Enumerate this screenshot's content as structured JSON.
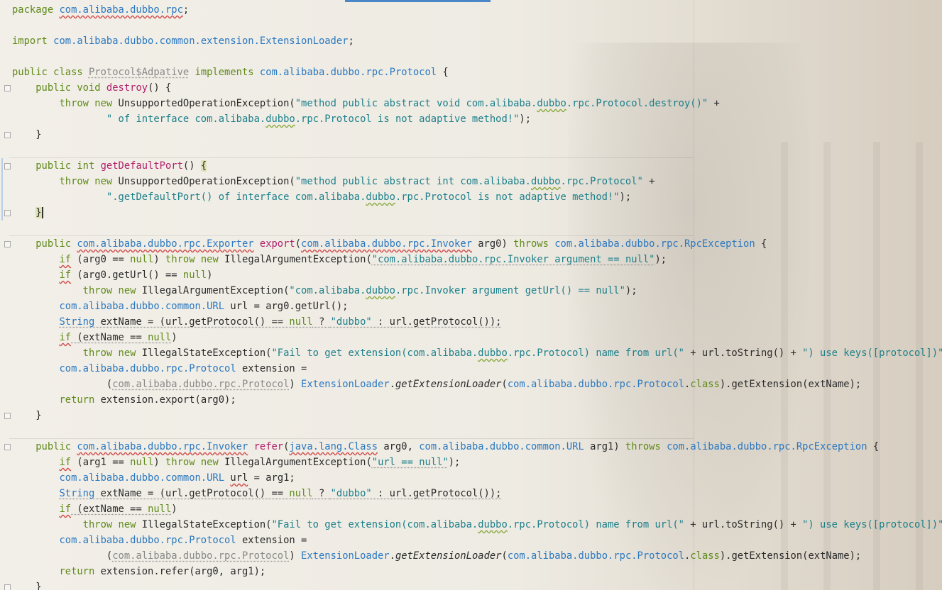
{
  "lines": [
    [
      {
        "t": "package ",
        "c": "kw"
      },
      {
        "t": "com.alibaba.dubbo.rpc",
        "c": "ty wv"
      },
      {
        "t": ";",
        "c": ""
      }
    ],
    [],
    [
      {
        "t": "import ",
        "c": "kw"
      },
      {
        "t": "com.alibaba.dubbo.common.extension.ExtensionLoader",
        "c": "ty"
      },
      {
        "t": ";",
        "c": ""
      }
    ],
    [],
    [
      {
        "t": "public class ",
        "c": "kw"
      },
      {
        "t": "Protocol$Adpative",
        "c": "grey dots"
      },
      {
        "t": " implements ",
        "c": "kw"
      },
      {
        "t": "com.alibaba.dubbo.rpc.Protocol",
        "c": "ty"
      },
      {
        "t": " {",
        "c": ""
      }
    ],
    [
      {
        "t": "    public void ",
        "c": "kw"
      },
      {
        "t": "destroy",
        "c": "fn"
      },
      {
        "t": "() {",
        "c": ""
      }
    ],
    [
      {
        "t": "        throw new ",
        "c": "kw"
      },
      {
        "t": "UnsupportedOperationException(",
        "c": ""
      },
      {
        "t": "\"method public abstract void com.alibaba.",
        "c": "st"
      },
      {
        "t": "dubbo",
        "c": "st wvg"
      },
      {
        "t": ".rpc.Protocol.destroy()\"",
        "c": "st"
      },
      {
        "t": " +",
        "c": ""
      }
    ],
    [
      {
        "t": "                ",
        "c": ""
      },
      {
        "t": "\" of interface com.alibaba.",
        "c": "st"
      },
      {
        "t": "dubbo",
        "c": "st wvg"
      },
      {
        "t": ".rpc.Protocol is not adaptive method!\"",
        "c": "st"
      },
      {
        "t": ");",
        "c": ""
      }
    ],
    [
      {
        "t": "    }",
        "c": ""
      }
    ],
    [],
    [
      {
        "t": "    public int ",
        "c": "kw"
      },
      {
        "t": "getDefaultPort",
        "c": "fn"
      },
      {
        "t": "() ",
        "c": ""
      },
      {
        "t": "{",
        "c": "hl"
      }
    ],
    [
      {
        "t": "        throw new ",
        "c": "kw"
      },
      {
        "t": "UnsupportedOperationException(",
        "c": ""
      },
      {
        "t": "\"method public abstract int com.alibaba.",
        "c": "st"
      },
      {
        "t": "dubbo",
        "c": "st wvg"
      },
      {
        "t": ".rpc.Protocol\"",
        "c": "st"
      },
      {
        "t": " +",
        "c": ""
      }
    ],
    [
      {
        "t": "                ",
        "c": ""
      },
      {
        "t": "\".getDefaultPort() of interface com.alibaba.",
        "c": "st"
      },
      {
        "t": "dubbo",
        "c": "st wvg"
      },
      {
        "t": ".rpc.Protocol is not adaptive method!\"",
        "c": "st"
      },
      {
        "t": ");",
        "c": ""
      }
    ],
    [
      {
        "t": "    ",
        "c": ""
      },
      {
        "t": "}",
        "c": "hl caret"
      }
    ],
    [],
    [
      {
        "t": "    public ",
        "c": "kw"
      },
      {
        "t": "com.alibaba.dubbo.rpc.Exporter",
        "c": "ty wv"
      },
      {
        "t": " ",
        "c": ""
      },
      {
        "t": "export",
        "c": "fn"
      },
      {
        "t": "(",
        "c": ""
      },
      {
        "t": "com.alibaba.dubbo.rpc.Invoker",
        "c": "ty wv"
      },
      {
        "t": " arg0) ",
        "c": ""
      },
      {
        "t": "throws ",
        "c": "kw"
      },
      {
        "t": "com.alibaba.dubbo.rpc.RpcException",
        "c": "ty"
      },
      {
        "t": " {",
        "c": ""
      }
    ],
    [
      {
        "t": "        ",
        "c": ""
      },
      {
        "t": "if",
        "c": "kw wv"
      },
      {
        "t": " (arg0 == ",
        "c": ""
      },
      {
        "t": "null",
        "c": "kw"
      },
      {
        "t": ") ",
        "c": ""
      },
      {
        "t": "throw new ",
        "c": "kw"
      },
      {
        "t": "IllegalArgumentException(",
        "c": ""
      },
      {
        "t": "\"com.alibaba.dubbo.rpc.Invoker argument == null\"",
        "c": "st dots"
      },
      {
        "t": ");",
        "c": ""
      }
    ],
    [
      {
        "t": "        ",
        "c": ""
      },
      {
        "t": "if",
        "c": "kw wv"
      },
      {
        "t": " (arg0.getUrl() == ",
        "c": ""
      },
      {
        "t": "null",
        "c": "kw"
      },
      {
        "t": ")",
        "c": ""
      }
    ],
    [
      {
        "t": "            throw new ",
        "c": "kw"
      },
      {
        "t": "IllegalArgumentException(",
        "c": ""
      },
      {
        "t": "\"com.alibaba.",
        "c": "st"
      },
      {
        "t": "dubbo",
        "c": "st wvg"
      },
      {
        "t": ".rpc.Invoker argument getUrl() == null\"",
        "c": "st"
      },
      {
        "t": ");",
        "c": ""
      }
    ],
    [
      {
        "t": "        ",
        "c": ""
      },
      {
        "t": "com.alibaba.dubbo.common.URL",
        "c": "ty"
      },
      {
        "t": " url = arg0.getUrl();",
        "c": ""
      }
    ],
    [
      {
        "t": "        ",
        "c": ""
      },
      {
        "t": "String",
        "c": "ty dots"
      },
      {
        "t": " extName = (url.getProtocol() == ",
        "c": "dots"
      },
      {
        "t": "null",
        "c": "kw dots"
      },
      {
        "t": " ? ",
        "c": "dots"
      },
      {
        "t": "\"dubbo\"",
        "c": "st dots"
      },
      {
        "t": " : url.getProtocol());",
        "c": "dots"
      }
    ],
    [
      {
        "t": "        ",
        "c": ""
      },
      {
        "t": "if",
        "c": "kw wv"
      },
      {
        "t": " (extName == ",
        "c": "dots"
      },
      {
        "t": "null",
        "c": "kw dots"
      },
      {
        "t": ")",
        "c": ""
      }
    ],
    [
      {
        "t": "            throw new ",
        "c": "kw"
      },
      {
        "t": "IllegalStateException(",
        "c": ""
      },
      {
        "t": "\"Fail to get extension(com.alibaba.",
        "c": "st"
      },
      {
        "t": "dubbo",
        "c": "st wvg"
      },
      {
        "t": ".rpc.Protocol) name from url(\"",
        "c": "st"
      },
      {
        "t": " + url.toString() + ",
        "c": ""
      },
      {
        "t": "\") use keys([protocol])\"",
        "c": "st"
      },
      {
        "t": ");",
        "c": ""
      }
    ],
    [
      {
        "t": "        ",
        "c": ""
      },
      {
        "t": "com.alibaba.dubbo.rpc.Protocol",
        "c": "ty"
      },
      {
        "t": " extension =",
        "c": ""
      }
    ],
    [
      {
        "t": "                (",
        "c": ""
      },
      {
        "t": "com.alibaba.dubbo.rpc.Protocol",
        "c": "grey dots"
      },
      {
        "t": ") ",
        "c": ""
      },
      {
        "t": "ExtensionLoader",
        "c": "ty"
      },
      {
        "t": ".",
        "c": ""
      },
      {
        "t": "getExtensionLoader",
        "c": "it"
      },
      {
        "t": "(",
        "c": ""
      },
      {
        "t": "com.alibaba.dubbo.rpc.Protocol",
        "c": "ty"
      },
      {
        "t": ".",
        "c": ""
      },
      {
        "t": "class",
        "c": "kw"
      },
      {
        "t": ").getExtension(extName);",
        "c": ""
      }
    ],
    [
      {
        "t": "        ",
        "c": ""
      },
      {
        "t": "return ",
        "c": "kw"
      },
      {
        "t": "extension.export(arg0);",
        "c": ""
      }
    ],
    [
      {
        "t": "    }",
        "c": ""
      }
    ],
    [],
    [
      {
        "t": "    public ",
        "c": "kw"
      },
      {
        "t": "com.alibaba.dubbo.rpc.Invoker",
        "c": "ty wv"
      },
      {
        "t": " ",
        "c": ""
      },
      {
        "t": "refer",
        "c": "fn"
      },
      {
        "t": "(",
        "c": ""
      },
      {
        "t": "java.lang.Class",
        "c": "ty wv"
      },
      {
        "t": " arg0, ",
        "c": ""
      },
      {
        "t": "com.alibaba.dubbo.common.URL",
        "c": "ty"
      },
      {
        "t": " arg1) ",
        "c": ""
      },
      {
        "t": "throws ",
        "c": "kw"
      },
      {
        "t": "com.alibaba.dubbo.rpc.RpcException",
        "c": "ty"
      },
      {
        "t": " {",
        "c": ""
      }
    ],
    [
      {
        "t": "        ",
        "c": ""
      },
      {
        "t": "if",
        "c": "kw wv"
      },
      {
        "t": " (arg1 == ",
        "c": ""
      },
      {
        "t": "null",
        "c": "kw"
      },
      {
        "t": ") ",
        "c": ""
      },
      {
        "t": "throw new ",
        "c": "kw"
      },
      {
        "t": "IllegalArgumentException(",
        "c": ""
      },
      {
        "t": "\"url == null\"",
        "c": "st dots"
      },
      {
        "t": ");",
        "c": ""
      }
    ],
    [
      {
        "t": "        ",
        "c": ""
      },
      {
        "t": "com.alibaba.dubbo.common.URL",
        "c": "ty"
      },
      {
        "t": " ",
        "c": ""
      },
      {
        "t": "url",
        "c": "wv"
      },
      {
        "t": " = arg1;",
        "c": ""
      }
    ],
    [
      {
        "t": "        ",
        "c": ""
      },
      {
        "t": "String",
        "c": "ty dots"
      },
      {
        "t": " extName = (url.getProtocol() == ",
        "c": "dots"
      },
      {
        "t": "null",
        "c": "kw dots"
      },
      {
        "t": " ? ",
        "c": "dots"
      },
      {
        "t": "\"dubbo\"",
        "c": "st dots"
      },
      {
        "t": " : url.getProtocol());",
        "c": "dots"
      }
    ],
    [
      {
        "t": "        ",
        "c": ""
      },
      {
        "t": "if",
        "c": "kw wv"
      },
      {
        "t": " (extName == ",
        "c": "dots"
      },
      {
        "t": "null",
        "c": "kw dots"
      },
      {
        "t": ")",
        "c": ""
      }
    ],
    [
      {
        "t": "            throw new ",
        "c": "kw"
      },
      {
        "t": "IllegalStateException(",
        "c": ""
      },
      {
        "t": "\"Fail to get extension(com.alibaba.",
        "c": "st"
      },
      {
        "t": "dubbo",
        "c": "st wvg"
      },
      {
        "t": ".rpc.Protocol) name from url(\"",
        "c": "st"
      },
      {
        "t": " + url.toString() + ",
        "c": ""
      },
      {
        "t": "\") use keys([protocol])\"",
        "c": "st"
      },
      {
        "t": ");",
        "c": ""
      }
    ],
    [
      {
        "t": "        ",
        "c": ""
      },
      {
        "t": "com.alibaba.dubbo.rpc.Protocol",
        "c": "ty"
      },
      {
        "t": " extension =",
        "c": ""
      }
    ],
    [
      {
        "t": "                (",
        "c": ""
      },
      {
        "t": "com.alibaba.dubbo.rpc.Protocol",
        "c": "grey dots"
      },
      {
        "t": ") ",
        "c": ""
      },
      {
        "t": "ExtensionLoader",
        "c": "ty"
      },
      {
        "t": ".",
        "c": ""
      },
      {
        "t": "getExtensionLoader",
        "c": "it"
      },
      {
        "t": "(",
        "c": ""
      },
      {
        "t": "com.alibaba.dubbo.rpc.Protocol",
        "c": "ty"
      },
      {
        "t": ".",
        "c": ""
      },
      {
        "t": "class",
        "c": "kw"
      },
      {
        "t": ").getExtension(extName);",
        "c": ""
      }
    ],
    [
      {
        "t": "        ",
        "c": ""
      },
      {
        "t": "return ",
        "c": "kw"
      },
      {
        "t": "extension.refer(arg0, arg1);",
        "c": ""
      }
    ],
    [
      {
        "t": "    }",
        "c": ""
      }
    ]
  ],
  "fold_lines": [
    5,
    8,
    10,
    13,
    15,
    26,
    28,
    37
  ],
  "separator_lines": [
    10,
    15,
    28
  ],
  "colors": {
    "keyword": "#5f8a1a",
    "method": "#b0206b",
    "type": "#2b78c0",
    "string": "#1c7f8a",
    "tab_indicator": "#4a86c8"
  }
}
